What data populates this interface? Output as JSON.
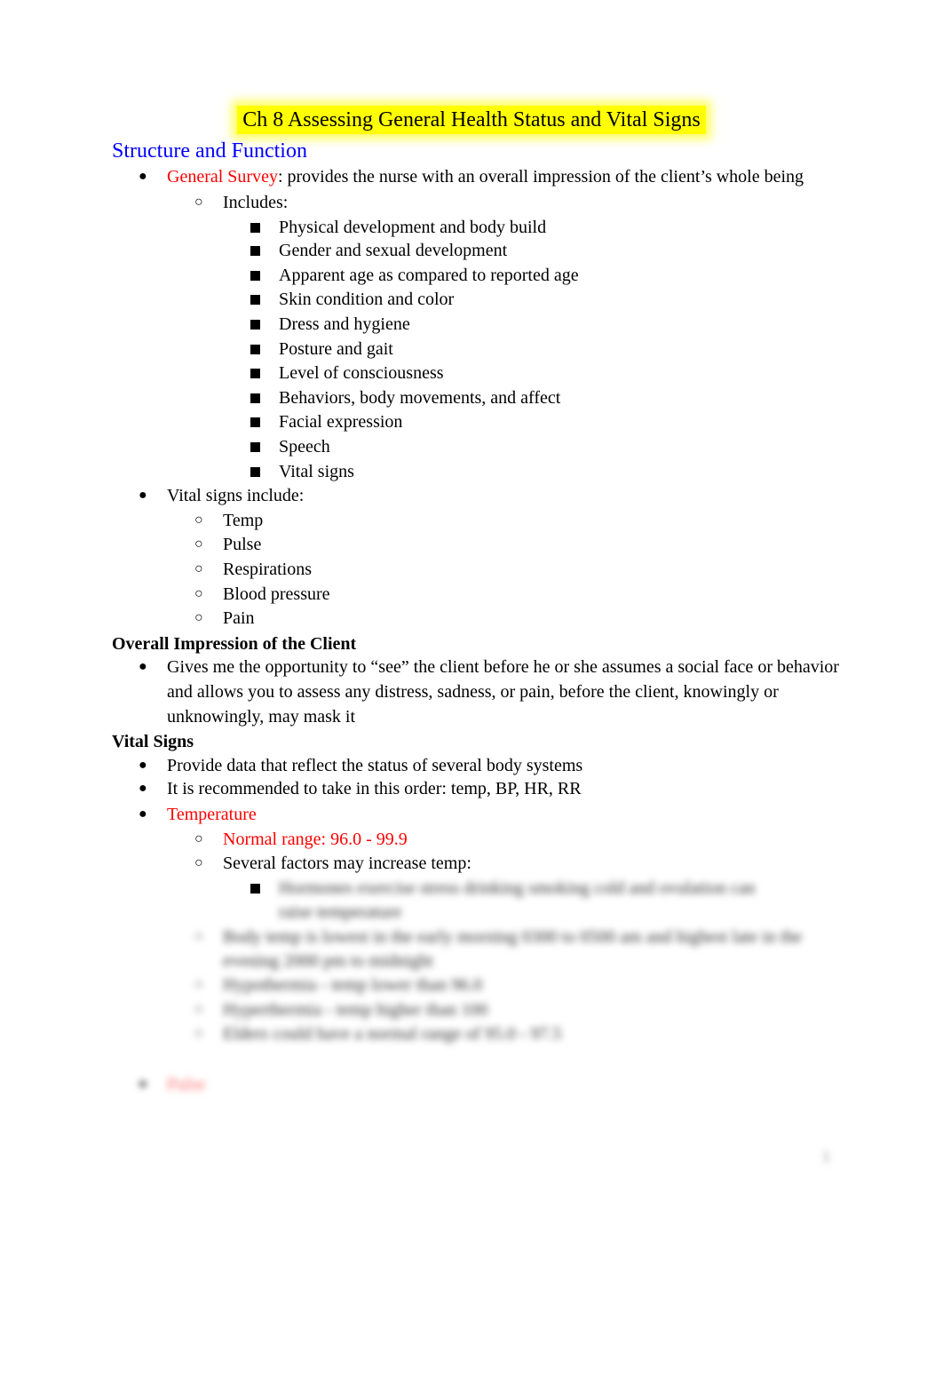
{
  "title": "Ch 8 Assessing General Health Status and Vital Signs",
  "sections": {
    "structure": {
      "heading": "Structure and Function",
      "general_survey_term": "General Survey",
      "general_survey_def": ": provides the nurse with an overall impression of the client’s whole being",
      "includes_label": "Includes:",
      "includes": [
        "Physical development and body build",
        "Gender and sexual development",
        "Apparent age as compared to reported age",
        "Skin condition and color",
        "Dress and hygiene",
        "Posture and gait",
        "Level of consciousness",
        "Behaviors, body movements, and affect",
        "Facial expression",
        "Speech",
        "Vital signs"
      ],
      "vitals_label": "Vital signs include:",
      "vitals": [
        "Temp",
        "Pulse",
        "Respirations",
        "Blood pressure",
        "Pain"
      ]
    },
    "impression": {
      "heading": "Overall Impression of the Client",
      "bullet": "Gives me the opportunity to “see” the client before he or she assumes a social face or behavior and allows you to assess any distress, sadness, or pain, before the client, knowingly or unknowingly, may mask it"
    },
    "vital_signs": {
      "heading": "Vital Signs",
      "bullets": [
        "Provide data that reflect the status of several body systems",
        "It is recommended to take in this order: temp, BP, HR, RR"
      ],
      "temperature_label": "Temperature",
      "normal_range": "Normal range: 96.0 - 99.9",
      "factors_label": "Several factors may increase temp:",
      "blurred": {
        "factor_line_1": "Hormones exercise stress drinking smoking cold and ovulation can",
        "factor_line_2": "raise temperature",
        "item_1_line_1": "Body temp is lowest in the early morning 0300 to 0500 am and highest late in the",
        "item_1_line_2": "evening 2000 pm to midnight",
        "item_2": "Hypothermia - temp lower than 96.0",
        "item_3": "Hyperthermia - temp higher than 100",
        "item_4": "Elders could have a normal range of 95.0 - 97.5",
        "next_heading": "Pulse"
      }
    }
  },
  "page_number": "1"
}
